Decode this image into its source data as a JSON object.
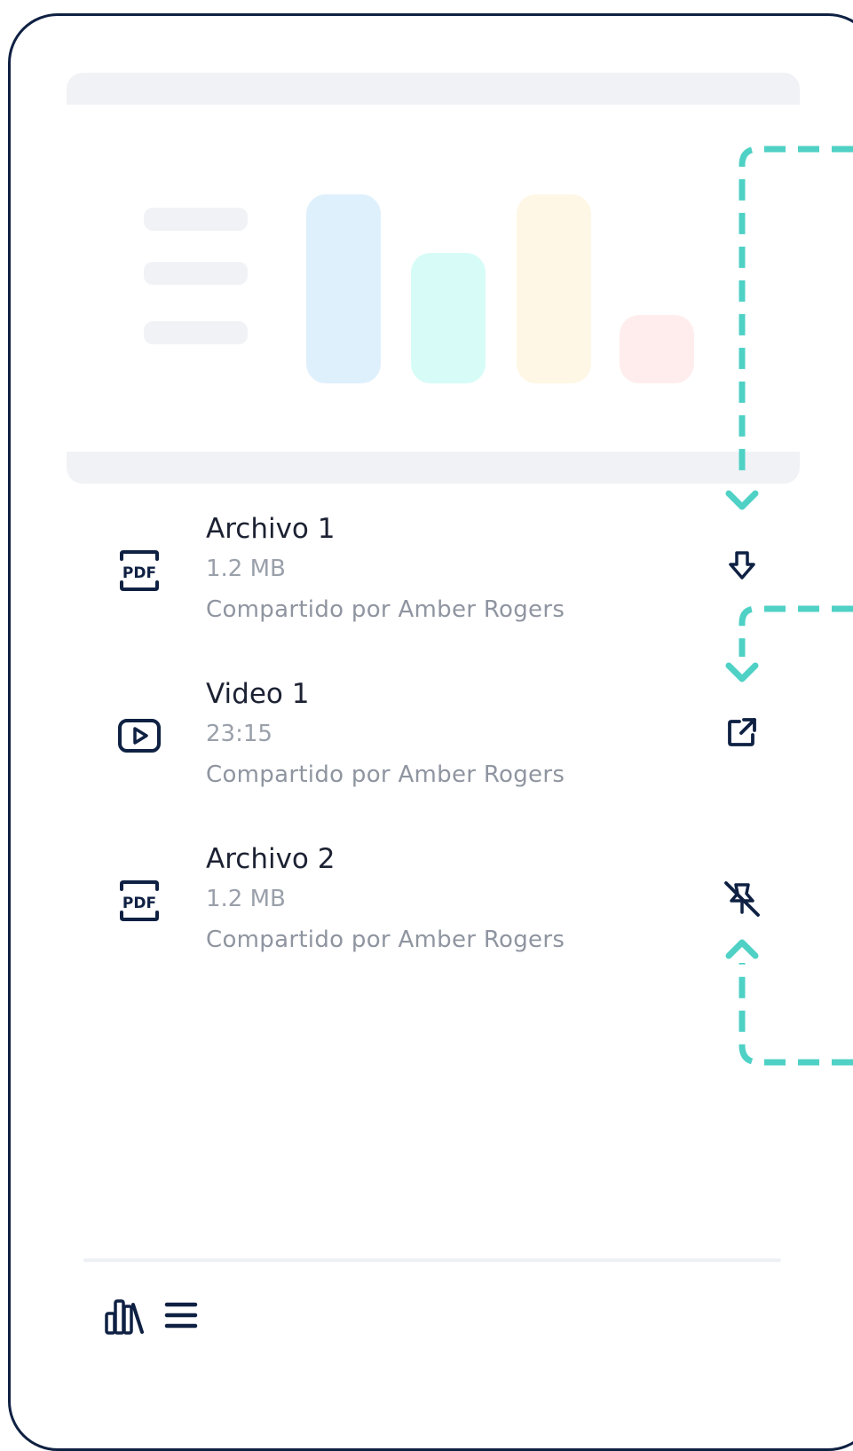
{
  "files": [
    {
      "name": "Archivo 1",
      "meta": "1.2 MB",
      "shared": "Compartido por Amber Rogers",
      "icon": "pdf-icon",
      "action": "download-icon"
    },
    {
      "name": "Video 1",
      "meta": "23:15",
      "shared": "Compartido por Amber Rogers",
      "icon": "video-play-icon",
      "action": "external-link-icon"
    },
    {
      "name": "Archivo 2",
      "meta": "1.2 MB",
      "shared": "Compartido por Amber Rogers",
      "icon": "pdf-icon",
      "action": "unpin-icon"
    }
  ],
  "preview_chart": {
    "bar_fill_levels": [
      1.0,
      0.69,
      1.0,
      0.36
    ],
    "bar_colors": [
      "#dff0fd",
      "#d7fcf7",
      "#fff7e5",
      "#ffeded"
    ]
  },
  "pdf_label": "PDF",
  "bottom_nav": [
    {
      "icon": "library-icon"
    },
    {
      "icon": "menu-icon"
    }
  ],
  "colors": {
    "frame": "#0f2143",
    "icon": "#0f2143",
    "guide": "#4fd1c5",
    "placeholder": "#f0f2f6",
    "text_primary": "#1c2233",
    "text_secondary": "#9aa0aa"
  }
}
